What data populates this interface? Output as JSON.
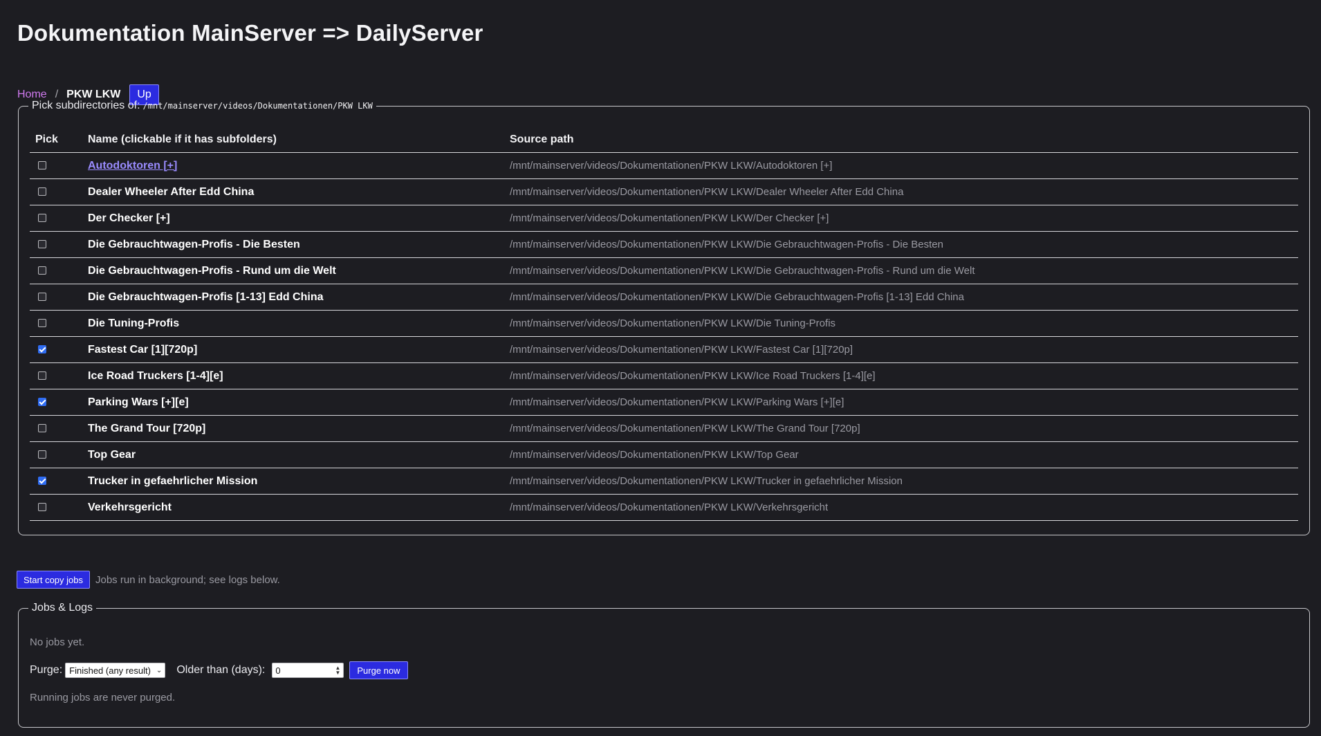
{
  "page": {
    "title": "Dokumentation MainServer => DailyServer"
  },
  "breadcrumb": {
    "home": "Home",
    "separator": "/",
    "current": "PKW LKW",
    "up_label": "Up"
  },
  "picker": {
    "legend": "Pick subdirectories of:",
    "base_path": "/mnt/mainserver/videos/Dokumentationen/PKW LKW",
    "columns": [
      "Pick",
      "Name (clickable if it has subfolders)",
      "Source path"
    ],
    "rows": [
      {
        "checked": false,
        "link": true,
        "name": "Autodoktoren [+]",
        "path": "/mnt/mainserver/videos/Dokumentationen/PKW LKW/Autodoktoren [+]"
      },
      {
        "checked": false,
        "link": false,
        "name": "Dealer Wheeler After Edd China",
        "path": "/mnt/mainserver/videos/Dokumentationen/PKW LKW/Dealer Wheeler After Edd China"
      },
      {
        "checked": false,
        "link": false,
        "name": "Der Checker [+]",
        "path": "/mnt/mainserver/videos/Dokumentationen/PKW LKW/Der Checker [+]"
      },
      {
        "checked": false,
        "link": false,
        "name": "Die Gebrauchtwagen-Profis - Die Besten",
        "path": "/mnt/mainserver/videos/Dokumentationen/PKW LKW/Die Gebrauchtwagen-Profis - Die Besten"
      },
      {
        "checked": false,
        "link": false,
        "name": "Die Gebrauchtwagen-Profis - Rund um die Welt",
        "path": "/mnt/mainserver/videos/Dokumentationen/PKW LKW/Die Gebrauchtwagen-Profis - Rund um die Welt"
      },
      {
        "checked": false,
        "link": false,
        "name": "Die Gebrauchtwagen-Profis [1-13] Edd China",
        "path": "/mnt/mainserver/videos/Dokumentationen/PKW LKW/Die Gebrauchtwagen-Profis [1-13] Edd China"
      },
      {
        "checked": false,
        "link": false,
        "name": "Die Tuning-Profis",
        "path": "/mnt/mainserver/videos/Dokumentationen/PKW LKW/Die Tuning-Profis"
      },
      {
        "checked": true,
        "link": false,
        "name": "Fastest Car [1][720p]",
        "path": "/mnt/mainserver/videos/Dokumentationen/PKW LKW/Fastest Car [1][720p]"
      },
      {
        "checked": false,
        "link": false,
        "name": "Ice Road Truckers [1-4][e]",
        "path": "/mnt/mainserver/videos/Dokumentationen/PKW LKW/Ice Road Truckers [1-4][e]"
      },
      {
        "checked": true,
        "link": false,
        "name": "Parking Wars [+][e]",
        "path": "/mnt/mainserver/videos/Dokumentationen/PKW LKW/Parking Wars [+][e]"
      },
      {
        "checked": false,
        "link": false,
        "name": "The Grand Tour [720p]",
        "path": "/mnt/mainserver/videos/Dokumentationen/PKW LKW/The Grand Tour [720p]"
      },
      {
        "checked": false,
        "link": false,
        "name": "Top Gear",
        "path": "/mnt/mainserver/videos/Dokumentationen/PKW LKW/Top Gear"
      },
      {
        "checked": true,
        "link": false,
        "name": "Trucker in gefaehrlicher Mission",
        "path": "/mnt/mainserver/videos/Dokumentationen/PKW LKW/Trucker in gefaehrlicher Mission"
      },
      {
        "checked": false,
        "link": false,
        "name": "Verkehrsgericht",
        "path": "/mnt/mainserver/videos/Dokumentationen/PKW LKW/Verkehrsgericht"
      }
    ]
  },
  "actions": {
    "start_label": "Start copy jobs",
    "hint": "Jobs run in background; see logs below."
  },
  "jobs": {
    "legend": "Jobs & Logs",
    "empty_text": "No jobs yet.",
    "purge_label": "Purge:",
    "purge_selected": "Finished (any result)",
    "older_label": "Older than (days):",
    "older_value": "0",
    "purge_button": "Purge now",
    "note": "Running jobs are never purged."
  },
  "colors": {
    "background": "#1d1d22",
    "accent_button": "#2b2be0",
    "link": "#9a8cff",
    "breadcrumb_link": "#d07af0",
    "checkbox_checked": "#2f6cf2"
  }
}
